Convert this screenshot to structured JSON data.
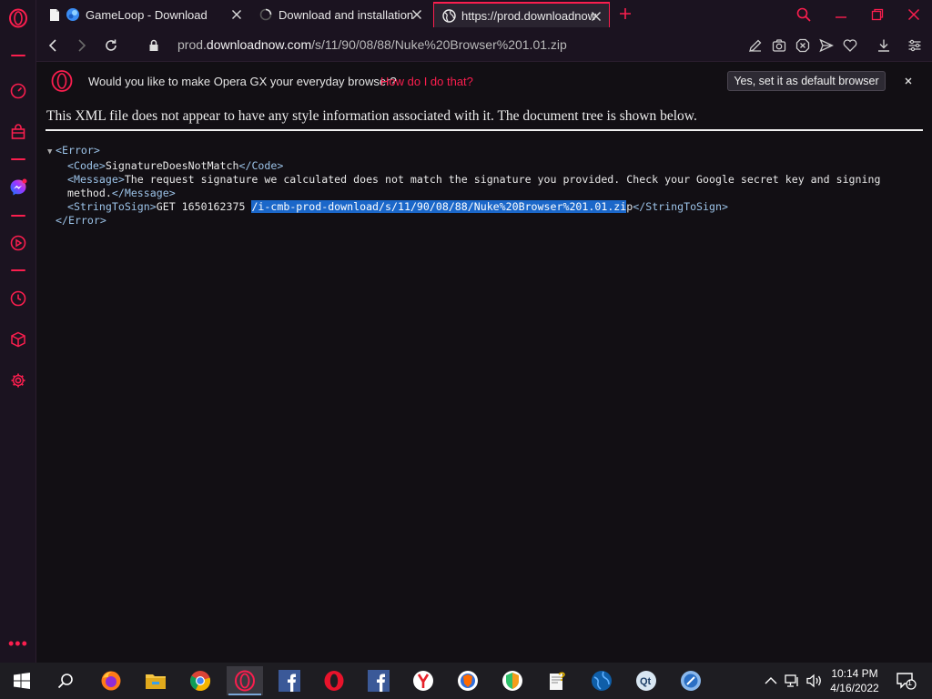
{
  "colors": {
    "accent": "#fa1e4e",
    "selection": "#1b67c9",
    "xml_tag": "#9cc3e8"
  },
  "sidebar": {
    "items": [
      {
        "icon": "speedometer-icon"
      },
      {
        "icon": "shopping-bag-icon"
      },
      {
        "icon": "messenger-icon",
        "badge": true
      },
      {
        "icon": "player-icon"
      },
      {
        "icon": "history-clock-icon"
      },
      {
        "icon": "cube-icon"
      },
      {
        "icon": "gear-icon"
      }
    ],
    "more": "•••"
  },
  "tabs": [
    {
      "title": "GameLoop - Download",
      "favicon": "document-icon"
    },
    {
      "title": "Download and installation",
      "favicon": "spinner-icon"
    },
    {
      "title": "https://prod.downloadnow",
      "favicon": "globe-icon",
      "active": true
    }
  ],
  "address": {
    "host_prefix": "prod.",
    "host_domain": "downloadnow.com",
    "path": "/s/11/90/08/88/Nuke%20Browser%201.01.zip"
  },
  "infobar": {
    "message": "Would you like to make Opera GX your everyday browser?",
    "link": "How do I do that?",
    "button": "Yes, set it as default browser"
  },
  "page": {
    "notice": "This XML file does not appear to have any style information associated with it. The document tree is shown below.",
    "xml": {
      "root_open": "<Error>",
      "root_close": "</Error>",
      "code_open": "<Code>",
      "code_value": "SignatureDoesNotMatch",
      "code_close": "</Code>",
      "message_open": "<Message>",
      "message_value_1": "The request signature we calculated does not match the signature you provided. Check your Google secret key and signing",
      "message_value_2": "method.",
      "message_close": "</Message>",
      "sts_open": "<StringToSign>",
      "sts_prefix": "GET 1650162375 ",
      "sts_selected": "/i-cmb-prod-download/s/11/90/08/88/Nuke%20Browser%201.01.zi",
      "sts_rest": "p",
      "sts_close": "</StringToSign>"
    }
  },
  "taskbar": {
    "apps": [
      "start-icon",
      "search-icon",
      "firefox-icon",
      "file-explorer-icon",
      "chrome-icon",
      "opera-gx-icon",
      "facebook-icon",
      "opera-icon",
      "facebook-icon",
      "yandex-icon",
      "brave-icon",
      "avast-browser-icon",
      "help-file-icon",
      "globe-browser-icon",
      "qt-icon",
      "browser-blue-icon"
    ],
    "time": "10:14 PM",
    "date": "4/16/2022",
    "notification_count": "1"
  }
}
